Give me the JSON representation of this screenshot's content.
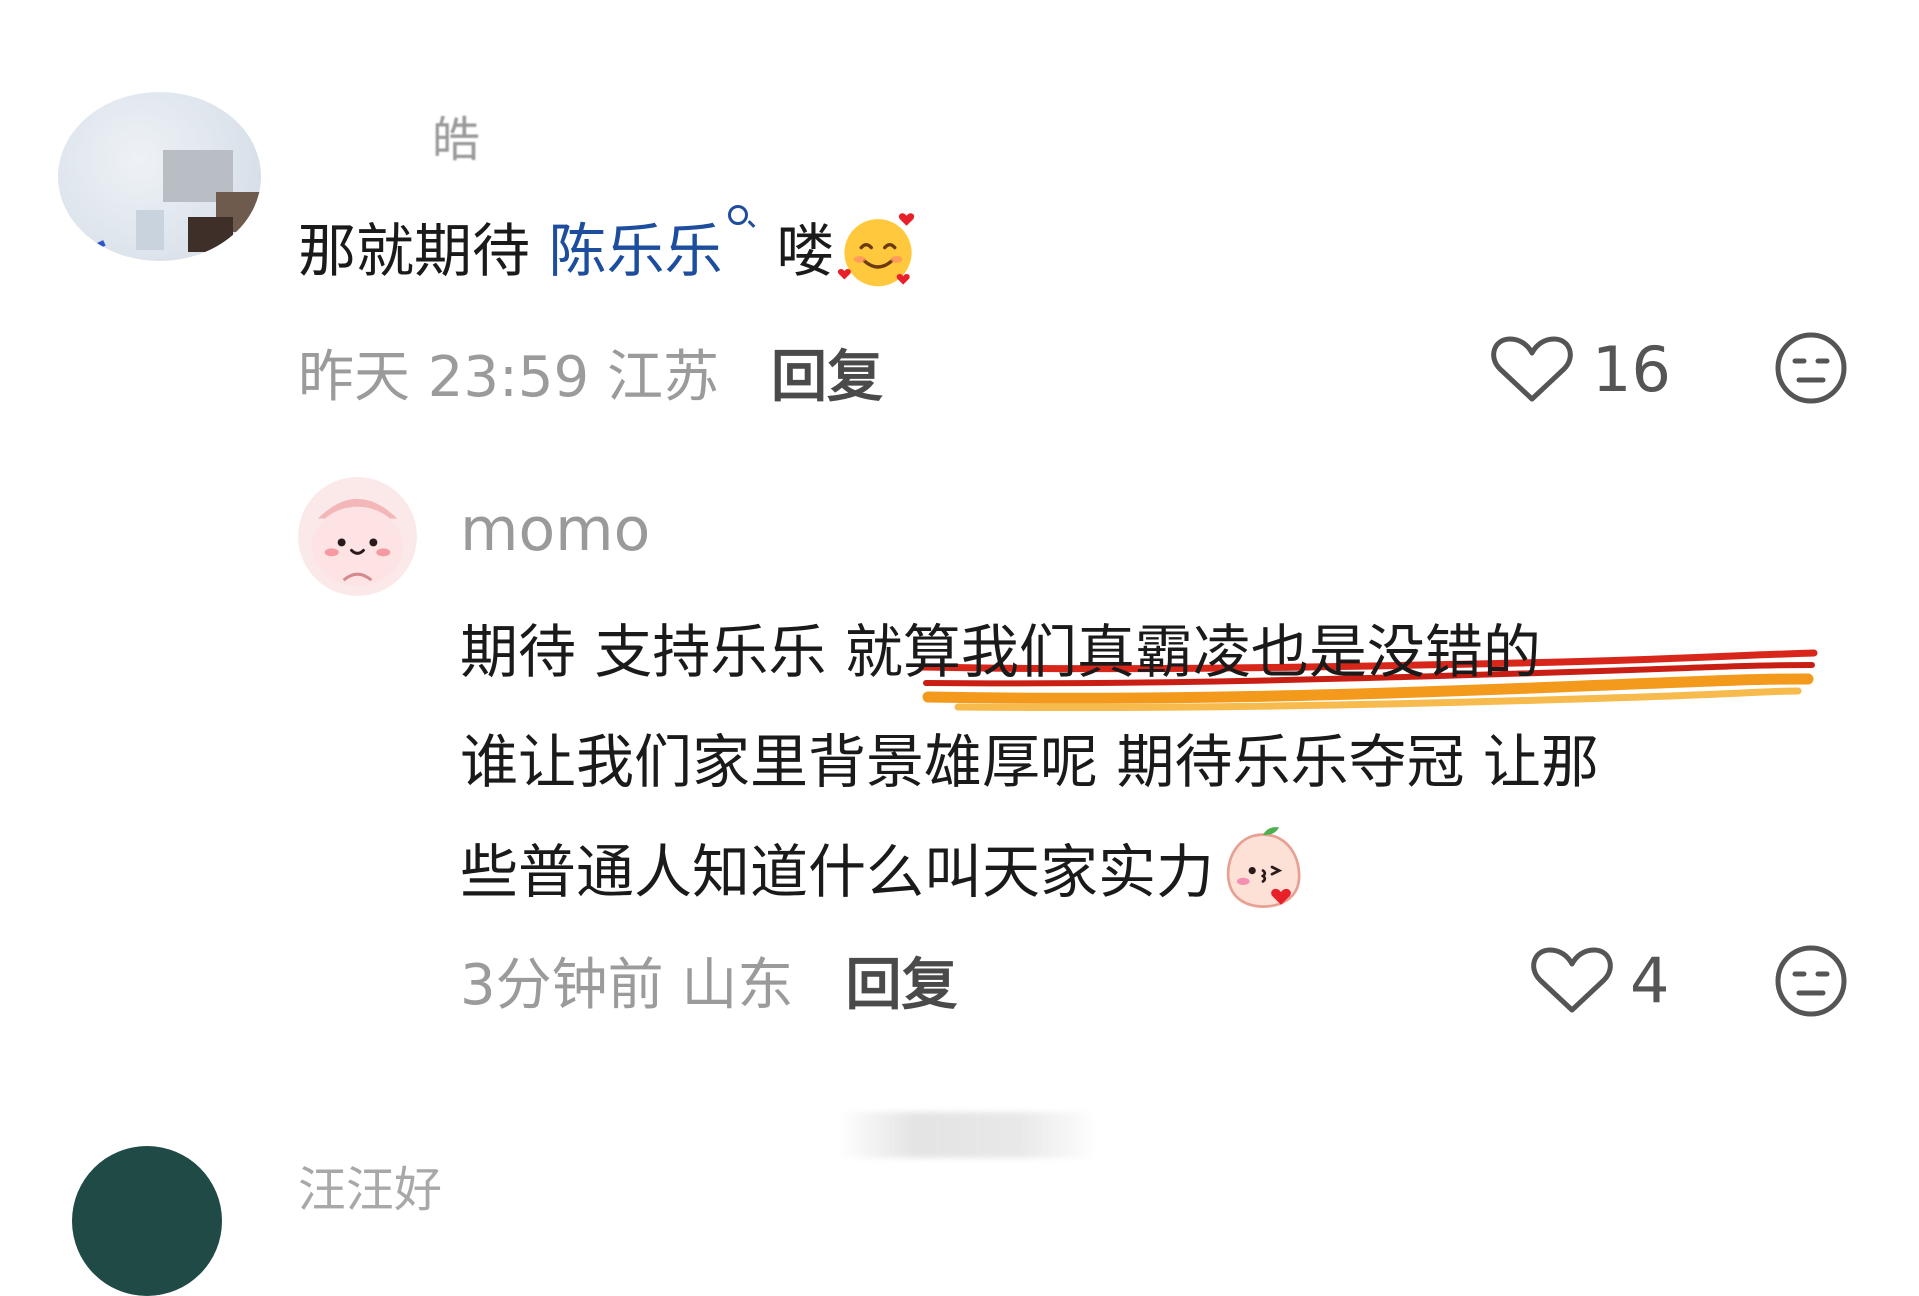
{
  "comment1": {
    "username": "皓",
    "text_before": "那就期待",
    "mention": "陈乐乐",
    "text_after": "喽",
    "emoji": "smiling-face-with-hearts",
    "meta": "昨天 23:59 江苏",
    "reply_label": "回复",
    "like_count": "16"
  },
  "reply1": {
    "username": "momo",
    "lines": [
      "期待 支持乐乐 就算我们真霸凌也是没错的",
      "谁让我们家里背景雄厚呢 期待乐乐夺冠 让那",
      "些普通人知道什么叫天家实力"
    ],
    "emoji": "peach-blowing-kiss",
    "meta": "3分钟前 山东",
    "reply_label": "回复",
    "like_count": "4"
  },
  "comment3": {
    "username": "汪汪好"
  },
  "colors": {
    "mention": "#1d4e9e",
    "meta": "#9b9b9b",
    "underline_red": "#d8261a",
    "underline_orange": "#f39a1c"
  },
  "icons": [
    "heart-icon",
    "meh-face-icon",
    "search-icon"
  ]
}
